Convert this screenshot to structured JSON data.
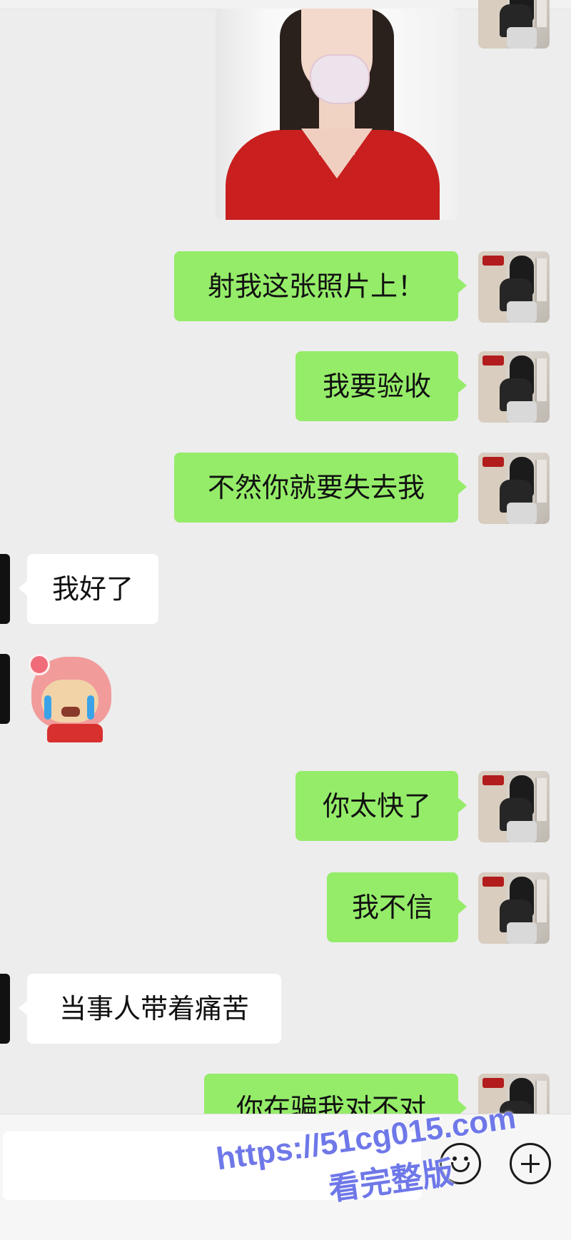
{
  "messages": [
    {
      "side": "me",
      "type": "image",
      "content": "selfie-photo"
    },
    {
      "side": "me",
      "type": "text",
      "text": "射我这张照片上！"
    },
    {
      "side": "me",
      "type": "text",
      "text": "我要验收"
    },
    {
      "side": "me",
      "type": "text",
      "text": "不然你就要失去我"
    },
    {
      "side": "them",
      "type": "text",
      "text": "我好了"
    },
    {
      "side": "them",
      "type": "sticker",
      "content": "crying-sticker"
    },
    {
      "side": "me",
      "type": "text",
      "text": "你太快了"
    },
    {
      "side": "me",
      "type": "text",
      "text": "我不信"
    },
    {
      "side": "them",
      "type": "text",
      "text": "当事人带着痛苦"
    },
    {
      "side": "me",
      "type": "text",
      "text": "你在骗我对不对"
    }
  ],
  "input_bar": {
    "input_value": "",
    "emoji_icon": "emoji-icon",
    "plus_icon": "plus-icon"
  },
  "watermark": {
    "url": "https://51cg015.com",
    "subtitle": "看完整版"
  },
  "colors": {
    "my_bubble": "#95ec69",
    "their_bubble": "#ffffff",
    "background": "#ededed",
    "watermark": "#6f78e8"
  }
}
